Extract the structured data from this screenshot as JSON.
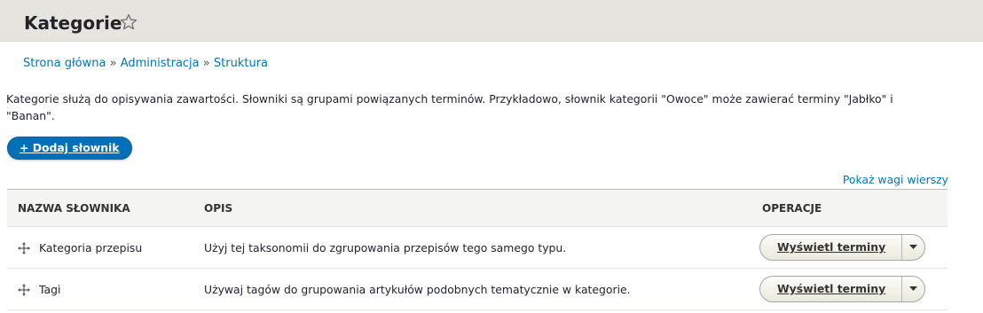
{
  "header": {
    "title": "Kategorie"
  },
  "breadcrumb": {
    "items": [
      "Strona główna",
      "Administracja",
      "Struktura"
    ],
    "separator": "»"
  },
  "description": "Kategorie służą do opisywania zawartości. Słowniki są grupami powiązanych terminów. Przykładowo, słownik kategorii \"Owoce\" może zawierać terminy \"Jabłko\" i \"Banan\".",
  "actions": {
    "add_vocabulary": "+ Dodaj słownik",
    "show_weights": "Pokaż wagi wierszy"
  },
  "table": {
    "headers": {
      "name": "NAZWA SŁOWNIKA",
      "description": "OPIS",
      "operations": "OPERACJE"
    },
    "rows": [
      {
        "name": "Kategoria przepisu",
        "description": "Użyj tej taksonomii do zgrupowania przepisów tego samego typu.",
        "operation": "Wyświetl terminy"
      },
      {
        "name": "Tagi",
        "description": "Używaj tagów do grupowania artykułów podobnych tematycznie w kategorie.",
        "operation": "Wyświetl terminy"
      }
    ]
  },
  "colors": {
    "link": "#0074bd",
    "primary_button": "#0071b8",
    "header_bg": "#e6e4df"
  },
  "icons": {
    "favorite": "star-outline-icon",
    "drag": "move-arrows-icon",
    "dropdown": "caret-down-icon"
  }
}
